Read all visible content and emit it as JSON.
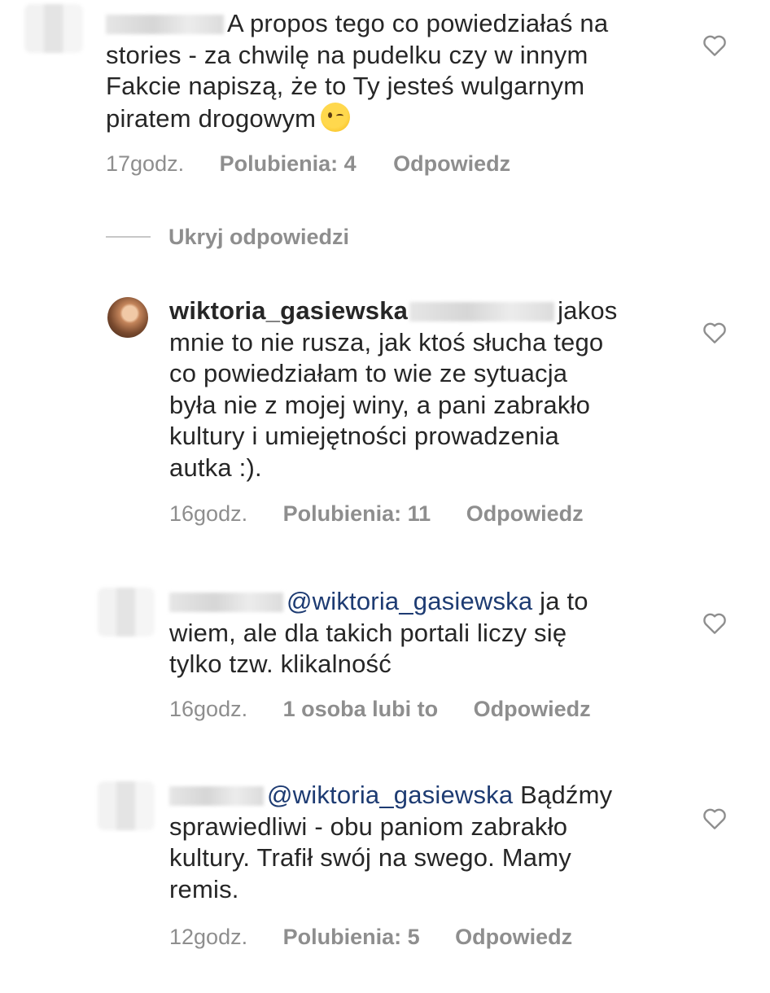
{
  "comments": [
    {
      "username": "",
      "text": "A propos tego co powiedziałaś na stories - za chwilę na pudelku czy w innym Fakcie napiszą, że to Ty jesteś wulgarnym piratem drogowym",
      "line1": "A propos tego co powiedziałaś na",
      "line2": "stories - za chwilę na pudelku czy w innym",
      "line3": "Fakcie napiszą, że to Ty jesteś wulgarnym",
      "line4": "piratem drogowym",
      "emoji": "winking-face",
      "time": "17godz.",
      "likes": "Polubienia: 4",
      "reply": "Odpowiedz"
    },
    {
      "username": "wiktoria_gasiewska",
      "line1": "jakos",
      "line2": "mnie to nie rusza, jak ktoś słucha tego",
      "line3": "co powiedziałam to wie ze sytuacja",
      "line4": "była nie z mojej winy, a pani zabrakło",
      "line5": "kultury i umiejętności prowadzenia",
      "line6": "autka :).",
      "time": "16godz.",
      "likes": "Polubienia: 11",
      "reply": "Odpowiedz"
    },
    {
      "mention": "@wiktoria_gasiewska",
      "line1": "ja to",
      "line2": "wiem, ale dla takich portali liczy się",
      "line3": "tylko tzw. klikalność",
      "time": "16godz.",
      "likes": "1 osoba lubi to",
      "reply": "Odpowiedz"
    },
    {
      "mention": "@wiktoria_gasiewska",
      "line1": "Bądźmy",
      "line2": "sprawiedliwi - obu paniom zabrakło",
      "line3": "kultury. Trafił swój na swego. Mamy",
      "line4": "remis.",
      "time": "12godz.",
      "likes": "Polubienia: 5",
      "reply": "Odpowiedz"
    }
  ],
  "hide_replies": "Ukryj odpowiedzi",
  "icons": {
    "like": "heart-outline-icon"
  },
  "colors": {
    "text": "#262626",
    "meta": "#8e8e8e",
    "mention": "#1d3b72",
    "background": "#ffffff"
  }
}
